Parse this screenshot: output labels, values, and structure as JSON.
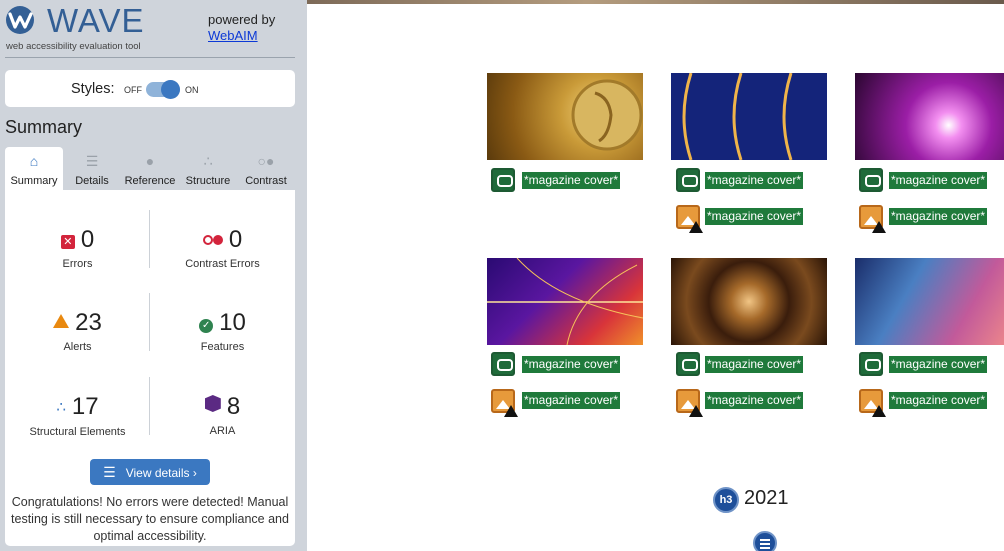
{
  "wave": {
    "brand": "WAVE",
    "tagline": "web accessibility evaluation tool",
    "powered_by": "powered by",
    "powered_link": "WebAIM",
    "styles": {
      "label": "Styles:",
      "off": "OFF",
      "on": "ON",
      "state": "on"
    },
    "summary_heading": "Summary",
    "tabs": [
      {
        "label": "Summary",
        "icon": "home-icon",
        "active": true
      },
      {
        "label": "Details",
        "icon": "list-icon",
        "active": false
      },
      {
        "label": "Reference",
        "icon": "info-icon",
        "active": false
      },
      {
        "label": "Structure",
        "icon": "structure-icon",
        "active": false
      },
      {
        "label": "Contrast",
        "icon": "contrast-icon",
        "active": false
      }
    ],
    "stats": {
      "errors": {
        "value": "0",
        "label": "Errors",
        "icon": "error-icon"
      },
      "contrast_errors": {
        "value": "0",
        "label": "Contrast Errors",
        "icon": "contrast-icon"
      },
      "alerts": {
        "value": "23",
        "label": "Alerts",
        "icon": "alert-icon"
      },
      "features": {
        "value": "10",
        "label": "Features",
        "icon": "feature-icon"
      },
      "structural": {
        "value": "17",
        "label": "Structural Elements",
        "icon": "structure-icon"
      },
      "aria": {
        "value": "8",
        "label": "ARIA",
        "icon": "aria-icon"
      }
    },
    "view_details": "View details ›",
    "congrats": "Congratulations! No errors were detected! Manual testing is still necessary to ensure compliance and optimal accessibility."
  },
  "page": {
    "alt_label": "*magazine cover*",
    "heading_badge": "h3",
    "year": "2021",
    "colors": {
      "alt_label_bg": "#1f7a3b",
      "wave_blue": "#3b78c1",
      "error_red": "#d3243c",
      "alert_orange": "#e9890f"
    }
  }
}
